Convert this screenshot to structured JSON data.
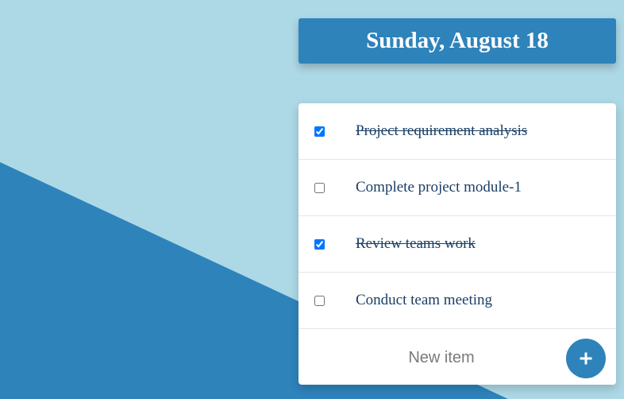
{
  "header": {
    "date": "Sunday, August 18"
  },
  "todo": {
    "items": [
      {
        "label": "Project requirement analysis",
        "checked": true
      },
      {
        "label": "Complete project module-1",
        "checked": false
      },
      {
        "label": "Review teams work",
        "checked": true
      },
      {
        "label": "Conduct team meeting",
        "checked": false
      }
    ],
    "new_item_placeholder": "New item",
    "add_button_icon": "plus-icon"
  },
  "colors": {
    "background_light": "#add8e6",
    "background_dark": "#2e83bb",
    "accent": "#2e83bb",
    "item_text": "#1a3f66"
  }
}
